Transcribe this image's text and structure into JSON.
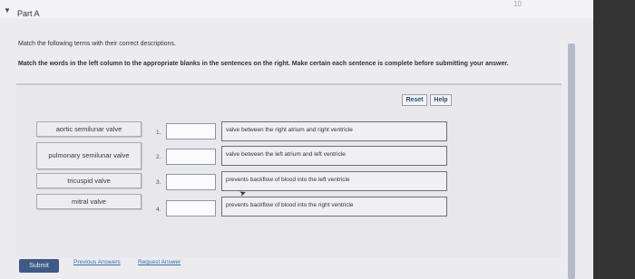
{
  "header": {
    "title": "Part A",
    "collapse_icon": "caret-down-icon",
    "corner_text": "10"
  },
  "instructions": {
    "intro": "Match the following terms with their correct descriptions.",
    "task": "Match the words in the left column to the appropriate blanks in the sentences on the right. Make certain each sentence is complete before submitting your answer."
  },
  "toolbar": {
    "reset_label": "Reset",
    "help_label": "Help"
  },
  "terms": [
    "aortic semilunar valve",
    "pulmonary semilunar valve",
    "tricuspid valve",
    "mitral valve"
  ],
  "blanks": [
    {
      "number": "1.",
      "sentence": "valve between the right atrium and right ventricle"
    },
    {
      "number": "2.",
      "sentence": "valve between the left atrium and left ventricle"
    },
    {
      "number": "3.",
      "sentence": "prevents backflow of blood into the left ventricle"
    },
    {
      "number": "4.",
      "sentence": "prevents backflow of blood into the right ventricle"
    }
  ],
  "footer": {
    "submit_label": "Submit",
    "previous_answers_label": "Previous Answers",
    "request_answer_label": "Request Answer"
  },
  "colors": {
    "submit_bg": "#3f5a86",
    "link": "#3a6ab0",
    "toolbar_text": "#2c4a7a"
  }
}
